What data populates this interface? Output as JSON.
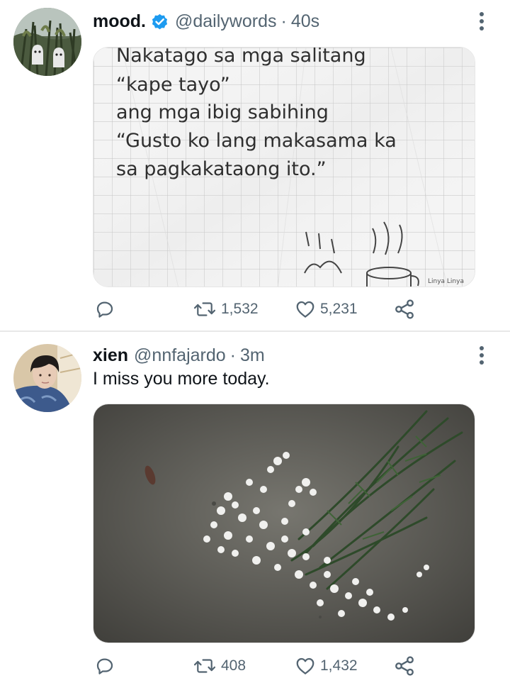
{
  "tweets": [
    {
      "display_name": "mood.",
      "verified": true,
      "handle": "@dailywords",
      "separator": "·",
      "time": "40s",
      "text": "",
      "media": {
        "type": "image",
        "note_lines": [
          "Nakatago sa mga salitang",
          "“kape tayo”",
          "ang mga ibig sabihing",
          "“Gusto ko lang makasama ka",
          "sa pagkakataong ito.”"
        ],
        "signature": "Linya Linya"
      },
      "actions": {
        "reply_count": "",
        "retweet_count": "1,532",
        "like_count": "5,231"
      }
    },
    {
      "display_name": "xien",
      "verified": false,
      "handle": "@nnfajardo",
      "separator": "·",
      "time": "3m",
      "text": "I miss you more today.",
      "media": {
        "type": "image"
      },
      "actions": {
        "reply_count": "",
        "retweet_count": "408",
        "like_count": "1,432"
      }
    }
  ],
  "icons": {
    "verified": "verified-badge-icon",
    "more": "more-vertical-icon",
    "reply": "reply-icon",
    "retweet": "retweet-icon",
    "like": "heart-icon",
    "share": "share-icon"
  },
  "colors": {
    "verified_blue": "#1d9bf0",
    "text_primary": "#0f1419",
    "text_secondary": "#536471",
    "divider": "#e8e8e8"
  }
}
